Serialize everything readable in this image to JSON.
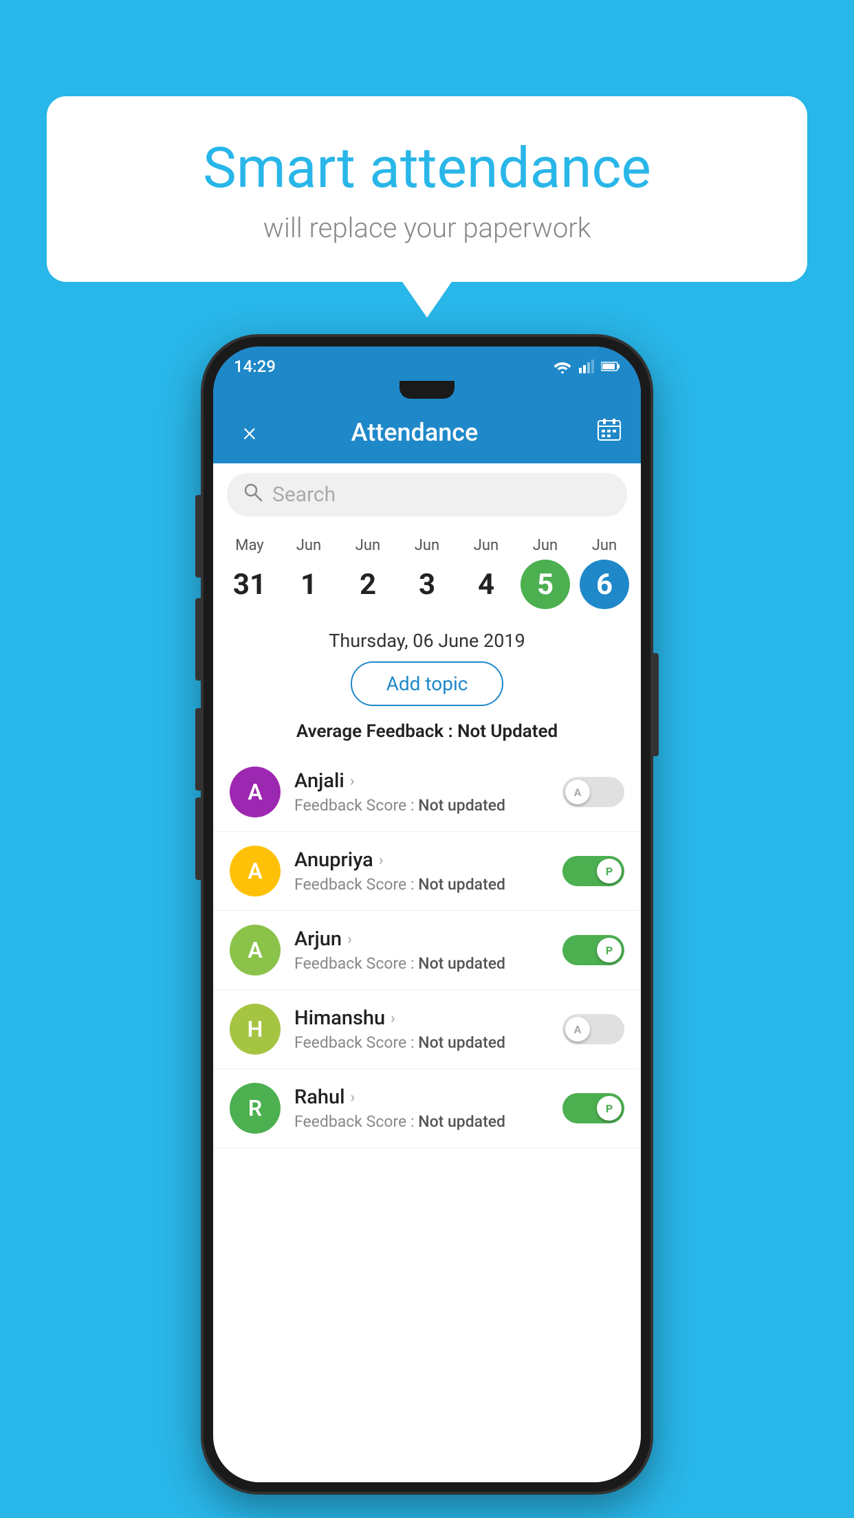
{
  "background_color": "#29b6e8",
  "speech_bubble": {
    "title": "Smart attendance",
    "subtitle": "will replace your paperwork"
  },
  "status_bar": {
    "time": "14:29"
  },
  "header": {
    "title": "Attendance",
    "close_label": "×"
  },
  "search": {
    "placeholder": "Search"
  },
  "calendar": {
    "dates": [
      {
        "month": "May",
        "day": "31",
        "state": "normal"
      },
      {
        "month": "Jun",
        "day": "1",
        "state": "normal"
      },
      {
        "month": "Jun",
        "day": "2",
        "state": "normal"
      },
      {
        "month": "Jun",
        "day": "3",
        "state": "normal"
      },
      {
        "month": "Jun",
        "day": "4",
        "state": "normal"
      },
      {
        "month": "Jun",
        "day": "5",
        "state": "today"
      },
      {
        "month": "Jun",
        "day": "6",
        "state": "selected"
      }
    ]
  },
  "selected_date_label": "Thursday, 06 June 2019",
  "add_topic_label": "Add topic",
  "avg_feedback_prefix": "Average Feedback : ",
  "avg_feedback_value": "Not Updated",
  "students": [
    {
      "name": "Anjali",
      "feedback_label": "Feedback Score : ",
      "feedback_value": "Not updated",
      "avatar_letter": "A",
      "avatar_color": "#9c27b0",
      "toggle_state": "off",
      "toggle_letter": "A"
    },
    {
      "name": "Anupriya",
      "feedback_label": "Feedback Score : ",
      "feedback_value": "Not updated",
      "avatar_letter": "A",
      "avatar_color": "#ffc107",
      "toggle_state": "on",
      "toggle_letter": "P"
    },
    {
      "name": "Arjun",
      "feedback_label": "Feedback Score : ",
      "feedback_value": "Not updated",
      "avatar_letter": "A",
      "avatar_color": "#8bc34a",
      "toggle_state": "on",
      "toggle_letter": "P"
    },
    {
      "name": "Himanshu",
      "feedback_label": "Feedback Score : ",
      "feedback_value": "Not updated",
      "avatar_letter": "H",
      "avatar_color": "#a5c442",
      "toggle_state": "off",
      "toggle_letter": "A"
    },
    {
      "name": "Rahul",
      "feedback_label": "Feedback Score : ",
      "feedback_value": "Not updated",
      "avatar_letter": "R",
      "avatar_color": "#4caf50",
      "toggle_state": "on",
      "toggle_letter": "P"
    }
  ]
}
